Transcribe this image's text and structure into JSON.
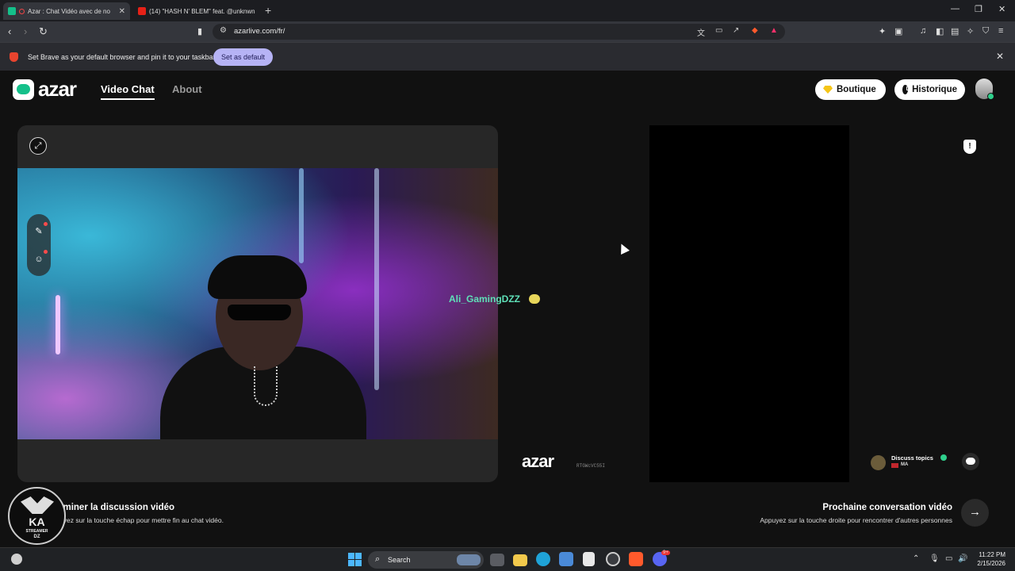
{
  "browser": {
    "tabs": [
      {
        "title": "Azar : Chat Vidéo avec de no",
        "active": true
      },
      {
        "title": "(14) \"HASH N' BLEM\" feat. @unknwn",
        "active": false
      }
    ],
    "new_tab": "+",
    "url": "azarlive.com/fr/",
    "infobar_message": "Set Brave as your default browser and pin it to your taskbar",
    "infobar_button": "Set as default",
    "window_controls": [
      "—",
      "❐",
      "✕"
    ]
  },
  "site": {
    "logo_text": "azar",
    "nav": {
      "video_chat": "Video Chat",
      "about": "About"
    },
    "buttons": {
      "shop": "Boutique",
      "history": "Historique"
    }
  },
  "chat": {
    "partner_name": "Ali_GamingDZZ",
    "watermark_logo": "azar",
    "watermark_code": "RTGWcVC55I",
    "topics": {
      "label": "Discuss topics",
      "country": "MA"
    },
    "end": {
      "title": "rminer la discussion vidéo",
      "subtitle": "uyez sur la touche échap pour mettre fin au chat vidéo."
    },
    "next": {
      "title": "Prochaine conversation vidéo",
      "subtitle": "Appuyez sur la touche droite pour rencontrer d'autres personnes"
    }
  },
  "streamer_logo": {
    "line1": "KA",
    "line2": "STREAMER",
    "line3": "DZ"
  },
  "taskbar": {
    "search_placeholder": "Search",
    "time": "11:22 PM",
    "date": "2/15/2026",
    "discord_badge": "9+"
  },
  "colors": {
    "accent_green": "#14c08a",
    "partner_name": "#5fe0b8",
    "infobar_button": "#b6b3f5"
  }
}
